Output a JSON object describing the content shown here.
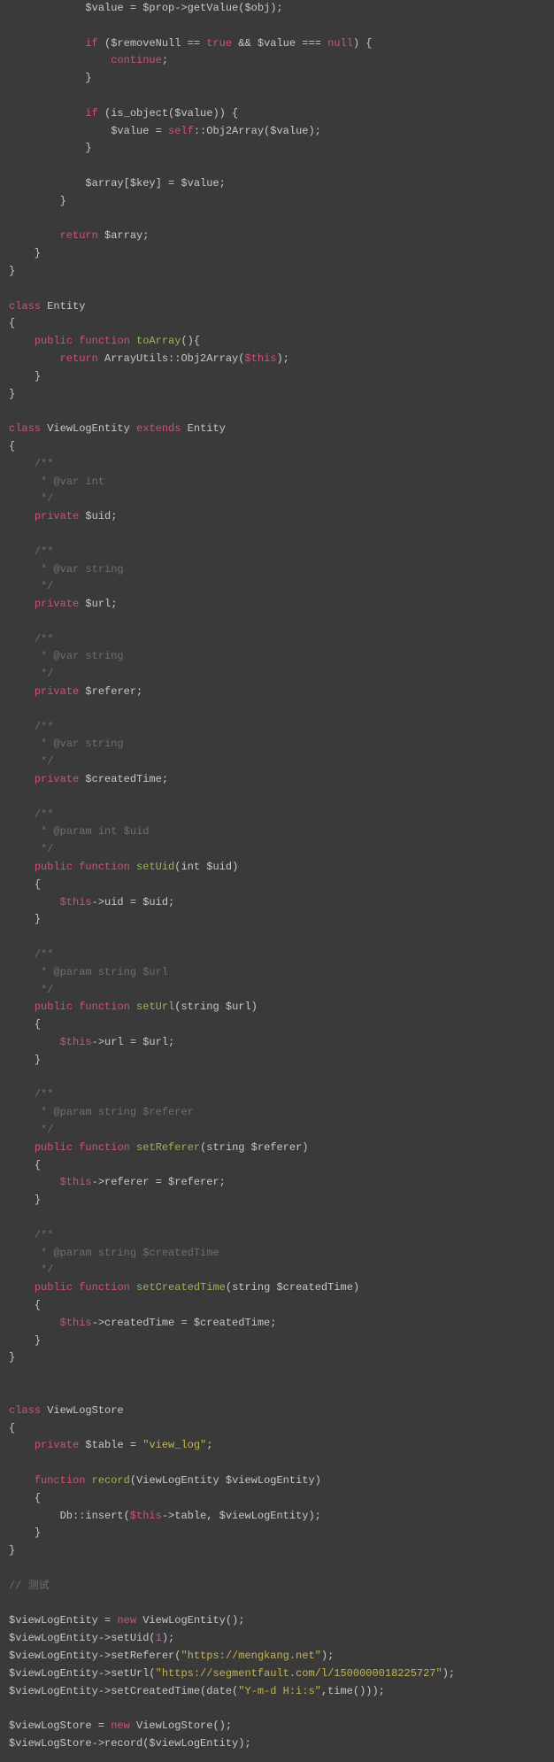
{
  "code": {
    "line1": "            $value = $prop->getValue($obj);",
    "line2_a": "if",
    "line2_b": " ($removeNull == ",
    "line2_c": "true",
    "line2_d": " && $value === ",
    "line2_e": "null",
    "line2_f": ") {",
    "line3_a": "continue",
    "line3_b": ";",
    "line4": "            }",
    "line5_a": "if",
    "line5_b": " (is_object($value)) {",
    "line6_a": "                $value = ",
    "line6_b": "self",
    "line6_c": "::Obj2Array($value);",
    "line7": "            }",
    "line8": "            $array[$key] = $value;",
    "line9": "        }",
    "line10_a": "return",
    "line10_b": " $array;",
    "line11": "    }",
    "line12": "}",
    "class_kw": "class",
    "entity_name": " Entity",
    "brace_open": "{",
    "brace_close": "}",
    "public_kw": "public",
    "function_kw": "function",
    "private_kw": "private",
    "return_kw": "return",
    "extends_kw": "extends",
    "new_kw": "new",
    "toArray_name": "toArray",
    "toArray_sig": "(){",
    "toArray_body_a": " ArrayUtils::Obj2Array(",
    "toArray_body_b": "$this",
    "toArray_body_c": ");",
    "viewLogEntity_decl": " ViewLogEntity ",
    "entity_parent": " Entity",
    "cmt_open": "/**",
    "cmt_var_int": " * @var int",
    "cmt_var_string": " * @var string",
    "cmt_param_int_uid": " * @param int $uid",
    "cmt_param_string_url": " * @param string $url",
    "cmt_param_string_referer": " * @param string $referer",
    "cmt_param_string_createdTime": " * @param string $createdTime",
    "cmt_close": " */",
    "field_uid": " $uid;",
    "field_url": " $url;",
    "field_referer": " $referer;",
    "field_createdTime": " $createdTime;",
    "setUid_name": "setUid",
    "setUid_sig": "(int $uid)",
    "setUid_body": "->uid = $uid;",
    "setUrl_name": "setUrl",
    "setUrl_sig": "(string $url)",
    "setUrl_body": "->url = $url;",
    "setReferer_name": "setReferer",
    "setReferer_sig": "(string $referer)",
    "setReferer_body": "->referer = $referer;",
    "setCreatedTime_name": "setCreatedTime",
    "setCreatedTime_sig": "(string $createdTime)",
    "setCreatedTime_body": "->createdTime = $createdTime;",
    "viewLogStore_decl": " ViewLogStore",
    "table_field_a": " $table = ",
    "table_str": "\"view_log\"",
    "table_field_b": ";",
    "record_name": "record",
    "record_sig": "(ViewLogEntity $viewLogEntity)",
    "record_body_a": "        Db::insert(",
    "record_body_b": "$this",
    "record_body_c": "->table, $viewLogEntity);",
    "test_cmt": "// 测试",
    "test1_a": "$viewLogEntity = ",
    "test1_b": " ViewLogEntity();",
    "test2_a": "$viewLogEntity->setUid(",
    "test2_num": "1",
    "test2_b": ");",
    "test3_a": "$viewLogEntity->setReferer(",
    "test3_str": "\"https://mengkang.net\"",
    "test3_b": ");",
    "test4_a": "$viewLogEntity->setUrl(",
    "test4_str": "\"https://segmentfault.com/l/1500000018225727\"",
    "test4_b": ");",
    "test5_a": "$viewLogEntity->setCreatedTime(date(",
    "test5_str": "\"Y-m-d H:i:s\"",
    "test5_b": ",time()));",
    "test6_a": "$viewLogStore = ",
    "test6_b": " ViewLogStore();",
    "test7": "$viewLogStore->record($viewLogEntity);"
  }
}
